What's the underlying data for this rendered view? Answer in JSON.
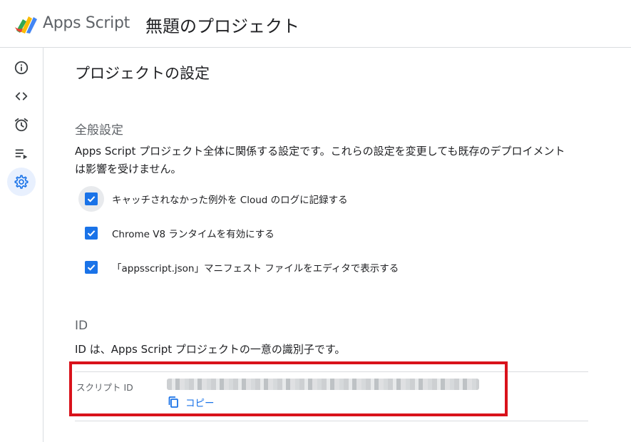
{
  "header": {
    "brand": "Apps Script",
    "project_title": "無題のプロジェクト"
  },
  "sidebar": {
    "items": [
      {
        "icon": "info-icon"
      },
      {
        "icon": "code-icon"
      },
      {
        "icon": "alarm-icon"
      },
      {
        "icon": "executions-icon"
      },
      {
        "icon": "gear-icon",
        "active": true
      }
    ]
  },
  "page": {
    "title": "プロジェクトの設定"
  },
  "general": {
    "title": "全般設定",
    "description": "Apps Script プロジェクト全体に関係する設定です。これらの設定を変更しても既存のデプロイメントは影響を受けません。",
    "options": [
      {
        "label": "キャッチされなかった例外を Cloud のログに記録する",
        "checked": true
      },
      {
        "label": "Chrome V8 ランタイムを有効にする",
        "checked": true
      },
      {
        "label": "「appsscript.json」マニフェスト ファイルをエディタで表示する",
        "checked": true
      }
    ]
  },
  "ids": {
    "title": "ID",
    "description": "ID は、Apps Script プロジェクトの一意の識別子です。",
    "script_id_label": "スクリプト ID",
    "copy_label": "コピー"
  },
  "colors": {
    "accent": "#1a73e8",
    "highlight": "#d9121b",
    "active_nav": "#e8f0fe"
  }
}
